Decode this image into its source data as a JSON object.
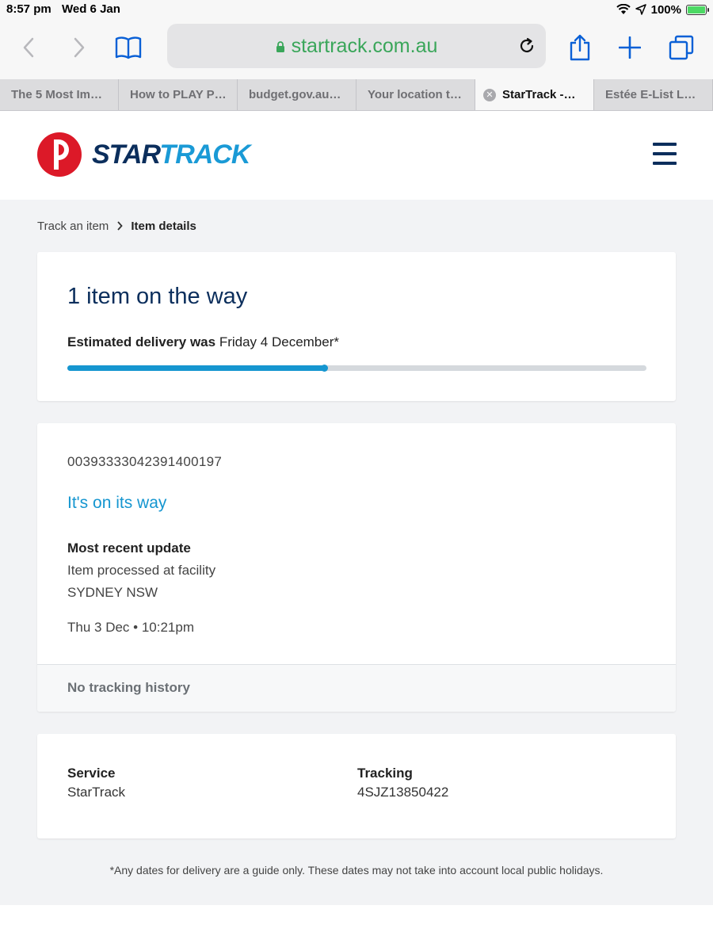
{
  "status_bar": {
    "time": "8:57 pm",
    "date": "Wed 6 Jan",
    "battery_percent": "100%",
    "battery_level": 1.0
  },
  "browser": {
    "url": "startrack.com.au",
    "tabs": [
      {
        "label": "The 5 Most Im…",
        "active": false
      },
      {
        "label": "How to PLAY P…",
        "active": false
      },
      {
        "label": "budget.gov.au…",
        "active": false
      },
      {
        "label": "Your location t…",
        "active": false
      },
      {
        "label": "StarTrack -…",
        "active": true
      },
      {
        "label": "Estée E-List L…",
        "active": false
      }
    ]
  },
  "site": {
    "logo_star": "STAR",
    "logo_track": "TRACK",
    "colors": {
      "navy": "#0b2e5c",
      "blue": "#1596d0",
      "red": "#dc1928"
    }
  },
  "breadcrumb": {
    "parent": "Track an item",
    "current": "Item details"
  },
  "summary": {
    "title": "1 item on the way",
    "estimate_label": "Estimated delivery was",
    "estimate_date": "Friday 4 December*",
    "progress": 0.445
  },
  "item": {
    "tracking_number": "00393333042391400197",
    "status": "It's on its way",
    "update_heading": "Most recent update",
    "update_description": "Item processed at facility",
    "update_location": "SYDNEY NSW",
    "update_time": "Thu 3 Dec • 10:21pm",
    "history_label": "No tracking history"
  },
  "details": {
    "service_label": "Service",
    "service_value": "StarTrack",
    "tracking_label": "Tracking",
    "tracking_value": "4SJZ13850422"
  },
  "disclaimer": "*Any dates for delivery are a guide only. These dates may not take into account local public holidays."
}
